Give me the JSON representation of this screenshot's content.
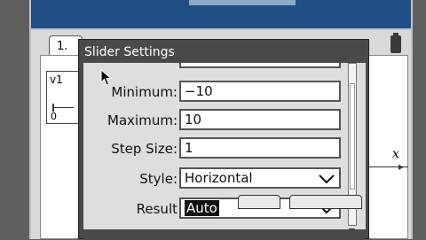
{
  "document": {
    "tab_label": "1.",
    "slider_var": "v1",
    "slider_min_tick": "0",
    "axis_label": "x"
  },
  "dialog": {
    "title": "Slider Settings",
    "fields": [
      {
        "label": "Minimum:",
        "value": "−10"
      },
      {
        "label": "Maximum:",
        "value": "10"
      },
      {
        "label": "Step Size:",
        "value": "1"
      }
    ],
    "style": {
      "label": "Style:",
      "value": "Horizontal"
    },
    "result": {
      "label": "Result",
      "value": "Auto"
    }
  },
  "icons": {
    "pointer": "arrow-cursor-icon",
    "dropdown": "chevron-down-icon",
    "battery": "battery-icon"
  }
}
